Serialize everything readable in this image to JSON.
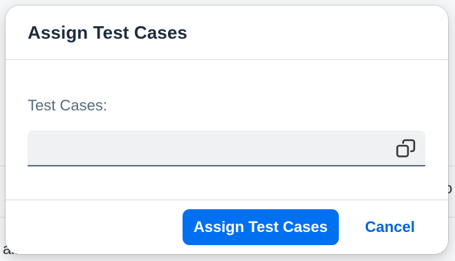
{
  "background": {
    "text_right": "o",
    "text_bottom": "ailable."
  },
  "dialog": {
    "title": "Assign Test Cases",
    "field": {
      "label": "Test Cases:",
      "value": "",
      "value_help_icon": "value-help-icon"
    },
    "footer": {
      "primary_label": "Assign Test Cases",
      "cancel_label": "Cancel"
    }
  },
  "colors": {
    "title": "#1d2d3e",
    "label": "#556b82",
    "primary_button": "#0070f2",
    "link_button": "#0064d9",
    "input_bg": "#eff1f2"
  }
}
